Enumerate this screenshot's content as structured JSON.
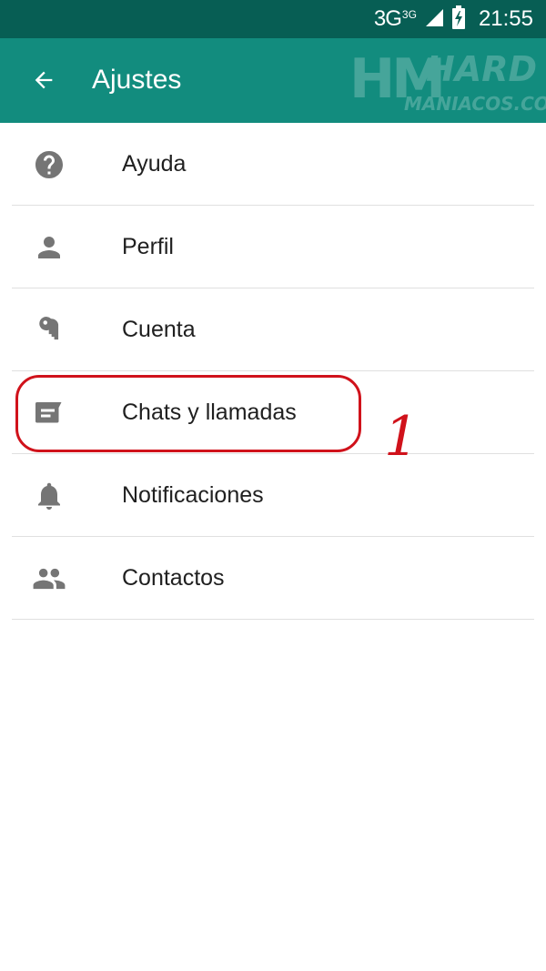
{
  "status_bar": {
    "network": "3G",
    "network_sup": "3G",
    "time": "21:55",
    "icons": [
      "signal-icon",
      "battery-charging-icon"
    ]
  },
  "app_bar": {
    "back_icon": "arrow-back-icon",
    "title": "Ajustes",
    "watermark": {
      "mark": "HM",
      "line1": "HARD",
      "line2": "MANIACOS.COM"
    }
  },
  "settings": {
    "items": [
      {
        "label": "Ayuda",
        "icon": "help-icon"
      },
      {
        "label": "Perfil",
        "icon": "person-icon"
      },
      {
        "label": "Cuenta",
        "icon": "key-icon"
      },
      {
        "label": "Chats y llamadas",
        "icon": "chat-icon"
      },
      {
        "label": "Notificaciones",
        "icon": "bell-icon"
      },
      {
        "label": "Contactos",
        "icon": "people-icon"
      }
    ]
  },
  "annotation": {
    "step": "1",
    "color": "#d0121b"
  },
  "colors": {
    "status_bar": "#075e54",
    "app_bar": "#128c7e",
    "icon_gray": "#757575"
  }
}
